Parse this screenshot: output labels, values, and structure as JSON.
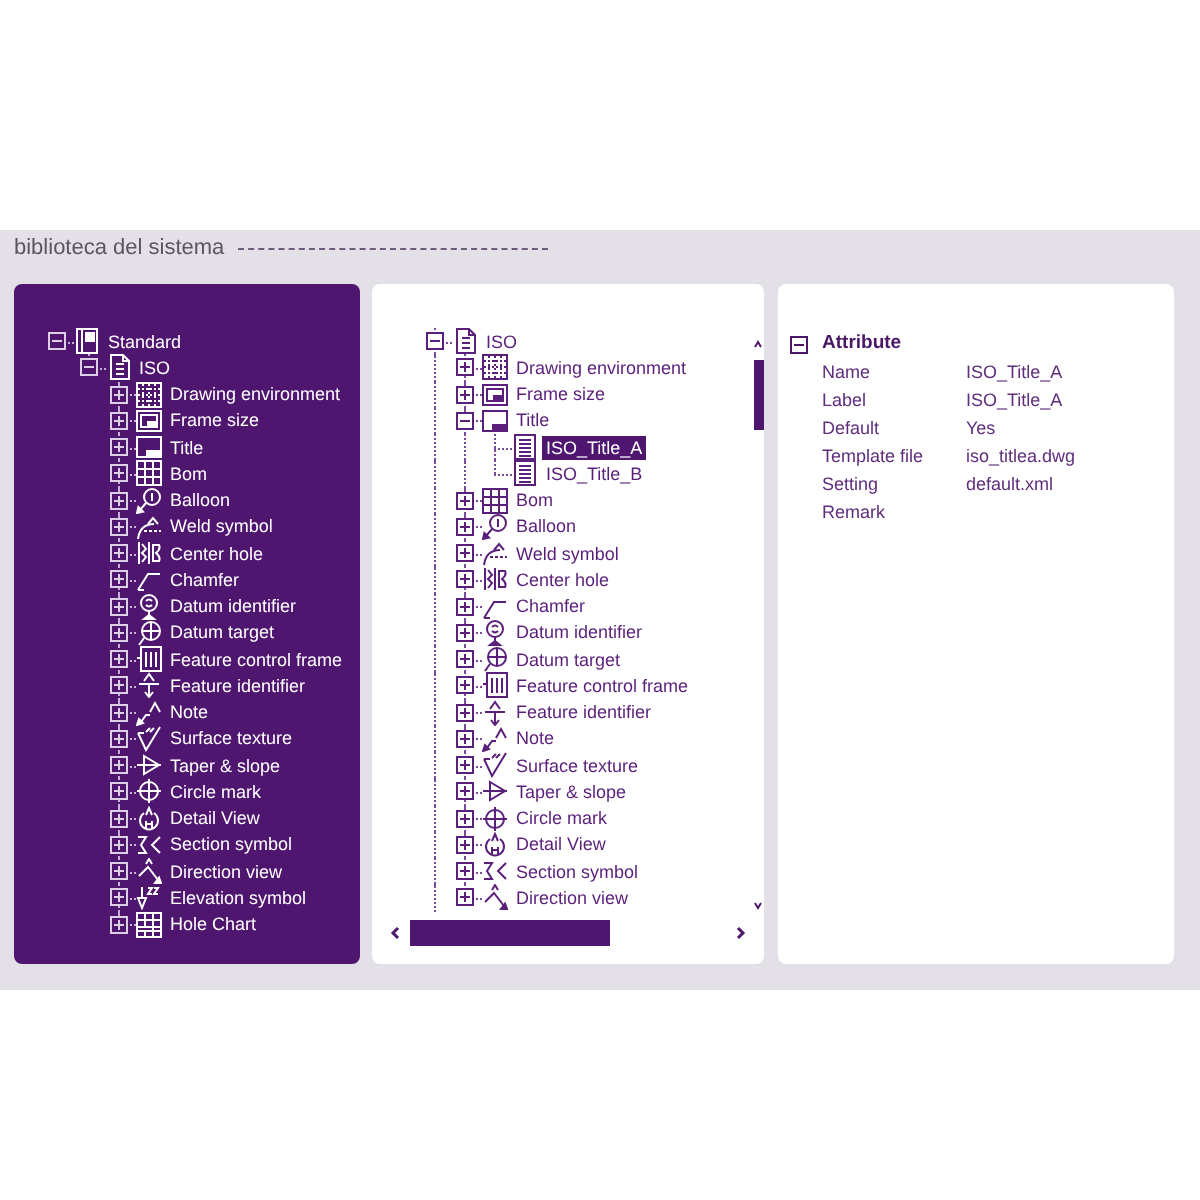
{
  "header": {
    "title": "biblioteca del sistema"
  },
  "standard_tree": {
    "items": [
      {
        "label": "Standard",
        "expanded": true,
        "selected": false,
        "children": [
          {
            "label": "ISO",
            "expanded": true,
            "selected": false,
            "children": [
              {
                "label": "Drawing environment",
                "expanded": false,
                "selected": false
              },
              {
                "label": "Frame size",
                "expanded": false,
                "selected": false
              },
              {
                "label": "Title",
                "expanded": false,
                "selected": false
              },
              {
                "label": "Bom",
                "expanded": false,
                "selected": false
              },
              {
                "label": "Balloon",
                "expanded": false,
                "selected": false
              },
              {
                "label": "Weld symbol",
                "expanded": false,
                "selected": false
              },
              {
                "label": "Center hole",
                "expanded": false,
                "selected": false
              },
              {
                "label": "Chamfer",
                "expanded": false,
                "selected": false
              },
              {
                "label": "Datum identifier",
                "expanded": false,
                "selected": false
              },
              {
                "label": "Datum target",
                "expanded": false,
                "selected": false
              },
              {
                "label": "Feature control frame",
                "expanded": false,
                "selected": false
              },
              {
                "label": "Feature identifier",
                "expanded": false,
                "selected": false
              },
              {
                "label": "Note",
                "expanded": false,
                "selected": false
              },
              {
                "label": "Surface texture",
                "expanded": false,
                "selected": false
              },
              {
                "label": "Taper & slope",
                "expanded": false,
                "selected": false
              },
              {
                "label": "Circle mark",
                "expanded": false,
                "selected": false
              },
              {
                "label": "Detail View",
                "expanded": false,
                "selected": false
              },
              {
                "label": "Section symbol",
                "expanded": false,
                "selected": false
              },
              {
                "label": "Direction view",
                "expanded": false,
                "selected": false
              },
              {
                "label": "Elevation symbol",
                "expanded": false,
                "selected": false
              },
              {
                "label": "Hole Chart",
                "expanded": false,
                "selected": false
              }
            ]
          }
        ]
      }
    ]
  },
  "library_tree": {
    "items": [
      {
        "label": "ISO",
        "expanded": true,
        "selected": false,
        "has_hidden_siblings": true,
        "children": [
          {
            "label": "Drawing environment",
            "expanded": false,
            "selected": false
          },
          {
            "label": "Frame size",
            "expanded": false,
            "selected": false
          },
          {
            "label": "Title",
            "expanded": true,
            "selected": false,
            "children": [
              {
                "label": "ISO_Title_A",
                "selected": true
              },
              {
                "label": "ISO_Title_B",
                "selected": false
              }
            ]
          },
          {
            "label": "Bom",
            "expanded": false,
            "selected": false
          },
          {
            "label": "Balloon",
            "expanded": false,
            "selected": false
          },
          {
            "label": "Weld symbol",
            "expanded": false,
            "selected": false
          },
          {
            "label": "Center hole",
            "expanded": false,
            "selected": false
          },
          {
            "label": "Chamfer",
            "expanded": false,
            "selected": false
          },
          {
            "label": "Datum identifier",
            "expanded": false,
            "selected": false
          },
          {
            "label": "Datum target",
            "expanded": false,
            "selected": false
          },
          {
            "label": "Feature control frame",
            "expanded": false,
            "selected": false
          },
          {
            "label": "Feature identifier",
            "expanded": false,
            "selected": false
          },
          {
            "label": "Note",
            "expanded": false,
            "selected": false
          },
          {
            "label": "Surface texture",
            "expanded": false,
            "selected": false
          },
          {
            "label": "Taper & slope",
            "expanded": false,
            "selected": false
          },
          {
            "label": "Circle mark",
            "expanded": false,
            "selected": false
          },
          {
            "label": "Detail View",
            "expanded": false,
            "selected": false
          },
          {
            "label": "Section symbol",
            "expanded": false,
            "selected": false
          },
          {
            "label": "Direction view",
            "expanded": false,
            "selected": false
          }
        ]
      }
    ]
  },
  "properties": {
    "group": {
      "label": "Attribute",
      "expanded": true
    },
    "rows": [
      {
        "name": "Name",
        "value": "ISO_Title_A"
      },
      {
        "name": "Label",
        "value": "ISO_Title_A"
      },
      {
        "name": "Default",
        "value": "Yes"
      },
      {
        "name": "Template file",
        "value": "iso_titlea.dwg"
      },
      {
        "name": "Setting",
        "value": "default.xml"
      },
      {
        "name": "Remark"
      }
    ]
  }
}
